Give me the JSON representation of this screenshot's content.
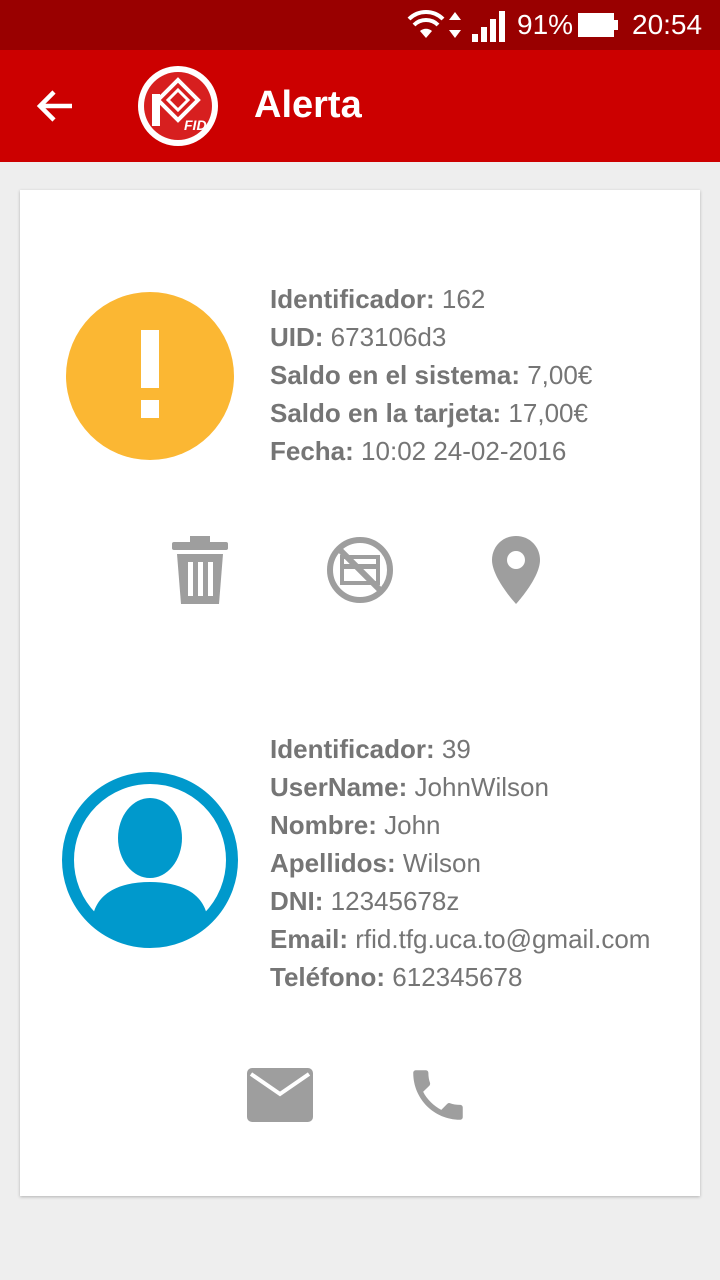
{
  "status_bar": {
    "battery": "91%",
    "time": "20:54",
    "icons": [
      "wifi-icon",
      "data-arrows-icon",
      "signal-icon",
      "battery-icon"
    ]
  },
  "app_bar": {
    "title": "Alerta",
    "logo_text": "RFID",
    "back_icon": "arrow-left-icon"
  },
  "alert": {
    "icon": "exclamation-circle-icon",
    "fields": [
      {
        "label": "Identificador:",
        "value": "162"
      },
      {
        "label": "UID:",
        "value": "673106d3"
      },
      {
        "label": "Saldo en el sistema:",
        "value": "7,00€"
      },
      {
        "label": "Saldo en la tarjeta:",
        "value": "17,00€"
      },
      {
        "label": "Fecha:",
        "value": "10:02 24-02-2016"
      }
    ],
    "actions": [
      "trash-icon",
      "block-card-icon",
      "location-pin-icon"
    ]
  },
  "user": {
    "icon": "user-avatar-icon",
    "fields": [
      {
        "label": "Identificador:",
        "value": "39"
      },
      {
        "label": "UserName:",
        "value": "JohnWilson"
      },
      {
        "label": "Nombre:",
        "value": "John"
      },
      {
        "label": "Apellidos:",
        "value": "Wilson"
      },
      {
        "label": "DNI:",
        "value": "12345678z"
      },
      {
        "label": "Email:",
        "value": "rfid.tfg.uca.to@gmail.com"
      },
      {
        "label": "Teléfono:",
        "value": "612345678"
      }
    ],
    "actions": [
      "mail-icon",
      "phone-icon"
    ]
  },
  "colors": {
    "status_bar": "#990000",
    "app_bar": "#cc0000",
    "alert_icon": "#fbb733",
    "avatar": "#0099cc",
    "action_icons": "#9e9e9e",
    "text": "#757575"
  }
}
